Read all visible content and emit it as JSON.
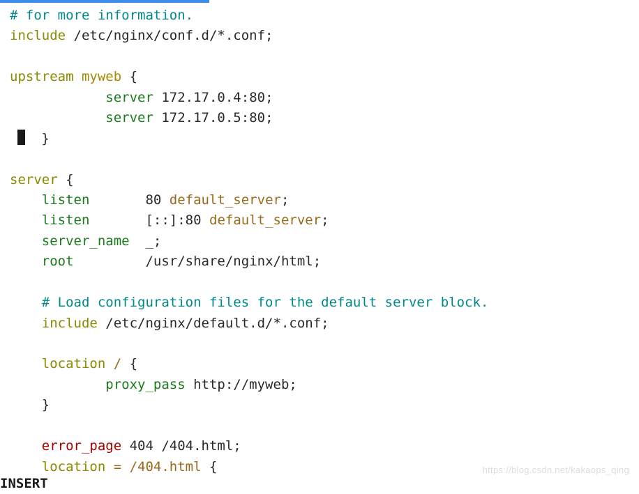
{
  "lines": [
    {
      "indent": "",
      "tokens": [
        {
          "t": "# for more information.",
          "c": "c-teal"
        }
      ]
    },
    {
      "indent": "",
      "tokens": [
        {
          "t": "include",
          "c": "c-olive"
        },
        {
          "t": " /etc/nginx/conf.d/*.conf;",
          "c": "c-plain"
        }
      ]
    },
    {
      "indent": "",
      "tokens": []
    },
    {
      "indent": "",
      "tokens": [
        {
          "t": "upstream",
          "c": "c-olive"
        },
        {
          "t": " ",
          "c": "c-plain"
        },
        {
          "t": "myweb",
          "c": "c-gold"
        },
        {
          "t": " {",
          "c": "c-plain"
        }
      ]
    },
    {
      "indent": "            ",
      "tokens": [
        {
          "t": "server",
          "c": "c-green"
        },
        {
          "t": " 172.17.0.4:80;",
          "c": "c-plain"
        }
      ]
    },
    {
      "indent": "            ",
      "tokens": [
        {
          "t": "server",
          "c": "c-green"
        },
        {
          "t": " 172.17.0.5:80;",
          "c": "c-plain"
        }
      ]
    },
    {
      "indent": " ",
      "cursor": true,
      "tokens": [
        {
          "t": "  }",
          "c": "c-plain"
        }
      ]
    },
    {
      "indent": "",
      "tokens": []
    },
    {
      "indent": "",
      "tokens": [
        {
          "t": "server",
          "c": "c-olive"
        },
        {
          "t": " {",
          "c": "c-plain"
        }
      ]
    },
    {
      "indent": "    ",
      "tokens": [
        {
          "t": "listen",
          "c": "c-green"
        },
        {
          "t": "       80 ",
          "c": "c-plain"
        },
        {
          "t": "default_server",
          "c": "c-brown"
        },
        {
          "t": ";",
          "c": "c-plain"
        }
      ]
    },
    {
      "indent": "    ",
      "tokens": [
        {
          "t": "listen",
          "c": "c-green"
        },
        {
          "t": "       [::]:80 ",
          "c": "c-plain"
        },
        {
          "t": "default_server",
          "c": "c-brown"
        },
        {
          "t": ";",
          "c": "c-plain"
        }
      ]
    },
    {
      "indent": "    ",
      "tokens": [
        {
          "t": "server_name",
          "c": "c-green"
        },
        {
          "t": "  _;",
          "c": "c-plain"
        }
      ]
    },
    {
      "indent": "    ",
      "tokens": [
        {
          "t": "root",
          "c": "c-green"
        },
        {
          "t": "         /usr/share/nginx/html;",
          "c": "c-plain"
        }
      ]
    },
    {
      "indent": "",
      "tokens": []
    },
    {
      "indent": "    ",
      "tokens": [
        {
          "t": "# Load configuration files for the default server block.",
          "c": "c-teal"
        }
      ]
    },
    {
      "indent": "    ",
      "tokens": [
        {
          "t": "include",
          "c": "c-olive"
        },
        {
          "t": " /etc/nginx/default.d/*.conf;",
          "c": "c-plain"
        }
      ]
    },
    {
      "indent": "",
      "tokens": []
    },
    {
      "indent": "    ",
      "tokens": [
        {
          "t": "location",
          "c": "c-olive"
        },
        {
          "t": " ",
          "c": "c-plain"
        },
        {
          "t": "/ ",
          "c": "c-brown"
        },
        {
          "t": "{",
          "c": "c-plain"
        }
      ]
    },
    {
      "indent": "            ",
      "tokens": [
        {
          "t": "proxy_pass",
          "c": "c-green"
        },
        {
          "t": " http://myweb;",
          "c": "c-plain"
        }
      ]
    },
    {
      "indent": "    ",
      "tokens": [
        {
          "t": "}",
          "c": "c-plain"
        }
      ]
    },
    {
      "indent": "",
      "tokens": []
    },
    {
      "indent": "    ",
      "tokens": [
        {
          "t": "error_page",
          "c": "c-red"
        },
        {
          "t": " 404 /404.html;",
          "c": "c-plain"
        }
      ]
    },
    {
      "indent": "    ",
      "tokens": [
        {
          "t": "location",
          "c": "c-olive"
        },
        {
          "t": " ",
          "c": "c-plain"
        },
        {
          "t": "= /404.html ",
          "c": "c-brown"
        },
        {
          "t": "{",
          "c": "c-plain"
        }
      ]
    }
  ],
  "bottom": "INSERT",
  "watermark": "https://blog.csdn.net/kakaops_qing"
}
